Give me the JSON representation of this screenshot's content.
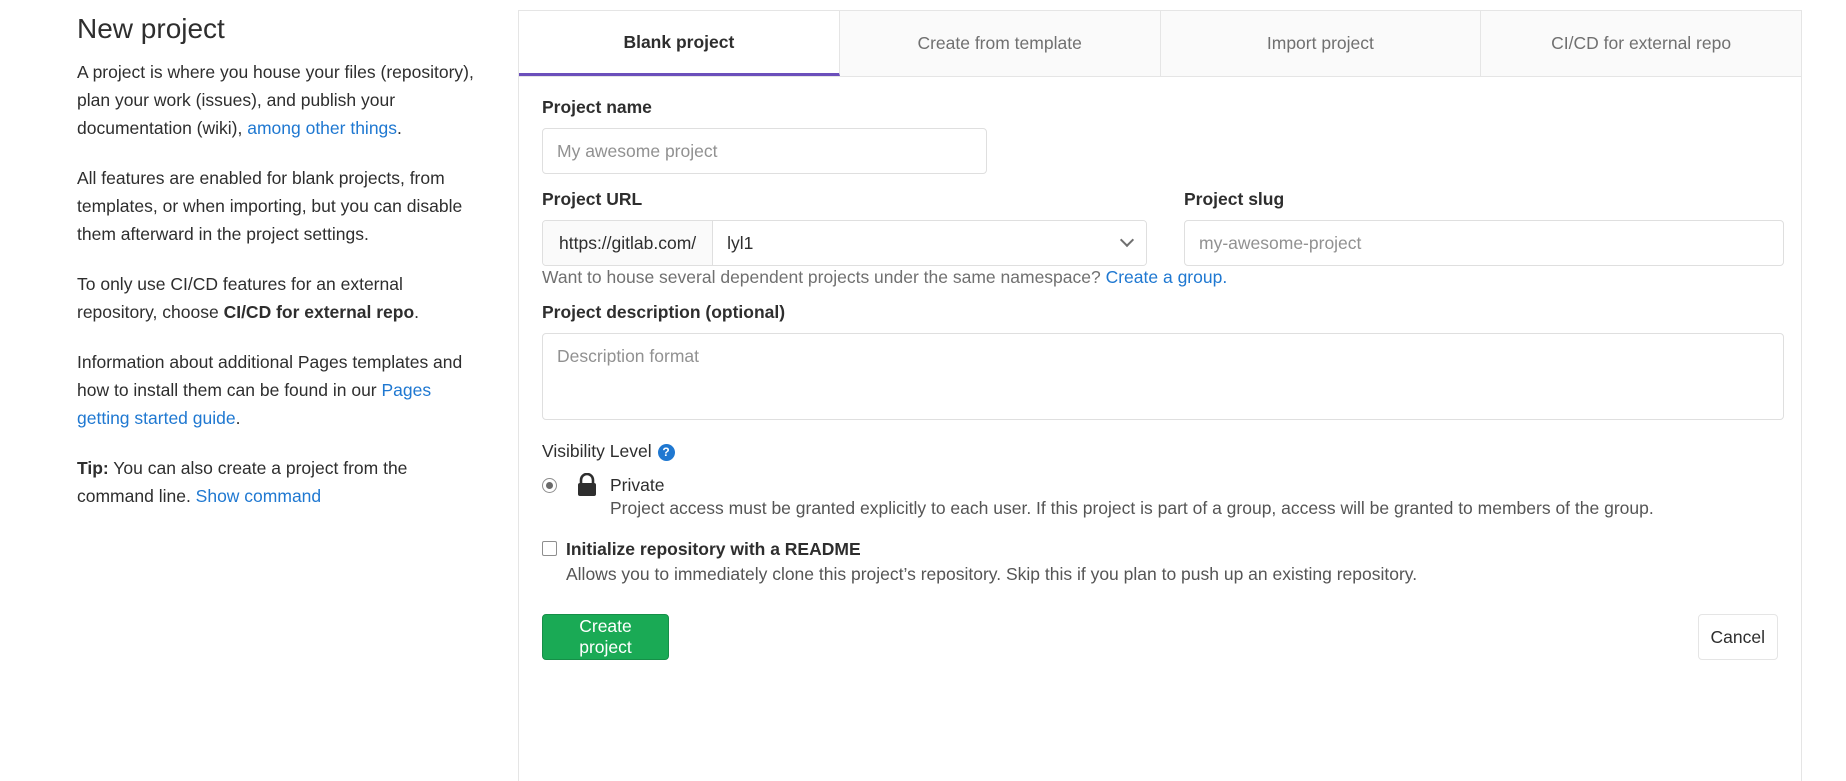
{
  "sidebar": {
    "title": "New project",
    "para1_text": "A project is where you house your files (repository), plan your work (issues), and publish your documentation (wiki), ",
    "para1_link": "among other things",
    "para1_end": ".",
    "para2": "All features are enabled for blank projects, from templates, or when importing, but you can disable them afterward in the project settings.",
    "para3_text": "To only use CI/CD features for an external repository, choose ",
    "para3_bold": "CI/CD for external repo",
    "para3_end": ".",
    "para4_text": "Information about additional Pages templates and how to install them can be found in our ",
    "para4_link": "Pages getting started guide",
    "para4_end": ".",
    "tip_label": "Tip:",
    "tip_text": " You can also create a project from the command line. ",
    "tip_link": "Show command"
  },
  "tabs": [
    {
      "label": "Blank project",
      "active": true
    },
    {
      "label": "Create from template",
      "active": false
    },
    {
      "label": "Import project",
      "active": false
    },
    {
      "label": "CI/CD for external repo",
      "active": false
    }
  ],
  "form": {
    "project_name_label": "Project name",
    "project_name_placeholder": "My awesome project",
    "project_url_label": "Project URL",
    "url_prefix": "https://gitlab.com/",
    "namespace_value": "lyl1",
    "project_slug_label": "Project slug",
    "project_slug_placeholder": "my-awesome-project",
    "namespace_help": "Want to house several dependent projects under the same namespace? ",
    "namespace_help_link": "Create a group.",
    "description_label": "Project description (optional)",
    "description_placeholder": "Description format",
    "visibility_label": "Visibility Level",
    "visibility_help_icon": "question-icon",
    "visibility_options": [
      {
        "label": "Private",
        "icon": "lock-icon",
        "selected": true,
        "description": "Project access must be granted explicitly to each user. If this project is part of a group, access will be granted to members of the group."
      }
    ],
    "readme_label": "Initialize repository with a README",
    "readme_checked": false,
    "readme_description": "Allows you to immediately clone this project’s repository. Skip this if you plan to push up an existing repository.",
    "create_button": "Create project",
    "cancel_button": "Cancel"
  },
  "colors": {
    "link": "#1f78d1",
    "tab_active_border": "#6b4fbb",
    "create_button": "#1aaa55"
  }
}
